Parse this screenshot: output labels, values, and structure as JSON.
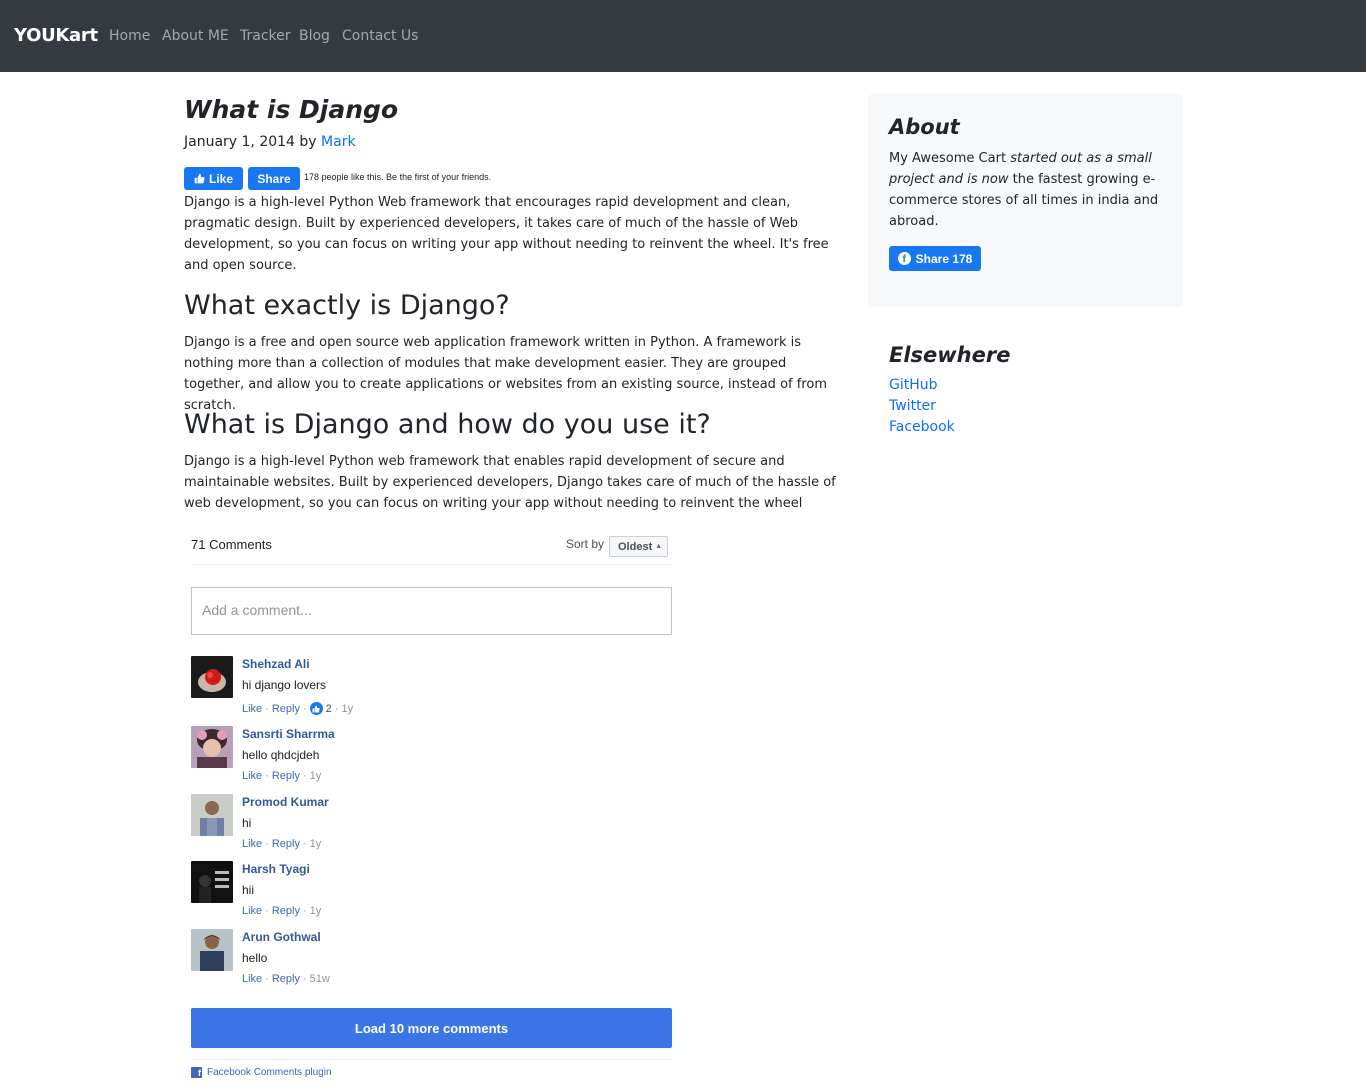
{
  "nav": {
    "brand": "YOUKart",
    "links": [
      "Home",
      "About ME",
      "Tracker",
      "Blog",
      "Contact Us"
    ]
  },
  "post": {
    "title": "What is Django",
    "date": "January 1, 2014",
    "by": "by",
    "author": "Mark",
    "fb": {
      "like_label": "Like",
      "share_label": "Share",
      "like_text": "178 people like this. Be the first of your friends."
    },
    "intro": "Django is a high-level Python Web framework that encourages rapid development and clean, pragmatic design. Built by experienced developers, it takes care of much of the hassle of Web development, so you can focus on writing your app without needing to reinvent the wheel. It's free and open source.",
    "section1_title": "What exactly is Django?",
    "section1_text": "Django is a free and open source web application framework written in Python. A framework is nothing more than a collection of modules that make development easier. They are grouped together, and allow you to create applications or websites from an existing source, instead of from scratch.",
    "section2_title": "What is Django and how do you use it?",
    "section2_text": "Django is a high-level Python web framework that enables rapid development of secure and maintainable websites. Built by experienced developers, Django takes care of much of the hassle of web development, so you can focus on writing your app without needing to reinvent the wheel"
  },
  "comments": {
    "count_label": "71 Comments",
    "sort_label": "Sort by",
    "sort_value": "Oldest",
    "input_placeholder": "Add a comment...",
    "like_label": "Like",
    "reply_label": "Reply",
    "items": [
      {
        "name": "Shehzad Ali",
        "text": "hi django lovers",
        "likes": "2",
        "age": "1y"
      },
      {
        "name": "Sansrti Sharrma",
        "text": "hello qhdcjdeh",
        "age": "1y"
      },
      {
        "name": "Promod Kumar",
        "text": "hi",
        "age": "1y"
      },
      {
        "name": "Harsh Tyagi",
        "text": "hii",
        "age": "1y"
      },
      {
        "name": "Arun Gothwal",
        "text": "hello",
        "age": "51w"
      }
    ],
    "load_more_label": "Load 10 more comments",
    "plugin_label": "Facebook Comments plugin"
  },
  "sidebar": {
    "about_title": "About",
    "about_text_1": "My Awesome Cart ",
    "about_text_2": "started out as a small project and is now",
    "about_text_3": " the fastest growing e-commerce stores of all times in india and abroad.",
    "share_label": "Share 178",
    "elsewhere_title": "Elsewhere",
    "links": [
      "GitHub",
      "Twitter",
      "Facebook"
    ]
  },
  "colors": {
    "navbar": "#343a40",
    "link": "#0d6efd",
    "facebook": "#1877f2",
    "fb_name": "#365899",
    "load_more": "#3b76e6"
  }
}
